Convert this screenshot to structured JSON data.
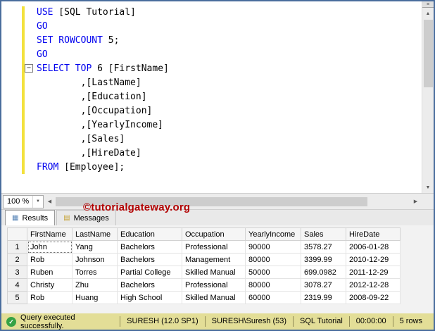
{
  "colors": {
    "frame": "#4a6d9d",
    "kw": "#0000ee",
    "changed": "#f3e13c",
    "wm": "#b20000",
    "status": "#e3de97"
  },
  "icons": {
    "check": "✓",
    "up": "▲",
    "down": "▼",
    "left": "◀",
    "right": "▶",
    "dropdown": "▼",
    "fold": "−",
    "grip": "≡",
    "results_tab": "▦",
    "messages_tab": "▤"
  },
  "editor": {
    "lines": [
      {
        "kw": "USE",
        "rest": " [SQL Tutorial]"
      },
      {
        "kw": "GO",
        "rest": ""
      },
      {
        "kw": "SET ROWCOUNT",
        "rest": " 5;"
      },
      {
        "kw": "GO",
        "rest": ""
      },
      {
        "kw": "SELECT TOP",
        "rest": " 6 [FirstName]"
      },
      {
        "kw": "",
        "rest": "        ,[LastName]"
      },
      {
        "kw": "",
        "rest": "        ,[Education]"
      },
      {
        "kw": "",
        "rest": "        ,[Occupation]"
      },
      {
        "kw": "",
        "rest": "        ,[YearlyIncome]"
      },
      {
        "kw": "",
        "rest": "        ,[Sales]"
      },
      {
        "kw": "",
        "rest": "        ,[HireDate]"
      },
      {
        "kw": "FROM",
        "rest": " [Employee];"
      }
    ],
    "zoom_level": "100 %"
  },
  "watermark": "©tutorialgateway.org",
  "results": {
    "tabs": [
      {
        "label": "Results"
      },
      {
        "label": "Messages"
      }
    ],
    "grid": {
      "columns": [
        "FirstName",
        "LastName",
        "Education",
        "Occupation",
        "YearlyIncome",
        "Sales",
        "HireDate"
      ],
      "rows": [
        {
          "num": "1",
          "cells": [
            "John",
            "Yang",
            "Bachelors",
            "Professional",
            "90000",
            "3578.27",
            "2006-01-28"
          ]
        },
        {
          "num": "2",
          "cells": [
            "Rob",
            "Johnson",
            "Bachelors",
            "Management",
            "80000",
            "3399.99",
            "2010-12-29"
          ]
        },
        {
          "num": "3",
          "cells": [
            "Ruben",
            "Torres",
            "Partial College",
            "Skilled Manual",
            "50000",
            "699.0982",
            "2011-12-29"
          ]
        },
        {
          "num": "4",
          "cells": [
            "Christy",
            "Zhu",
            "Bachelors",
            "Professional",
            "80000",
            "3078.27",
            "2012-12-28"
          ]
        },
        {
          "num": "5",
          "cells": [
            "Rob",
            "Huang",
            "High School",
            "Skilled Manual",
            "60000",
            "2319.99",
            "2008-09-22"
          ]
        }
      ]
    }
  },
  "status_bar": {
    "message": "Query executed successfully.",
    "server": "SURESH (12.0 SP1)",
    "user": "SURESH\\Suresh (53)",
    "database": "SQL Tutorial",
    "time": "00:00:00",
    "rows": "5 rows"
  }
}
